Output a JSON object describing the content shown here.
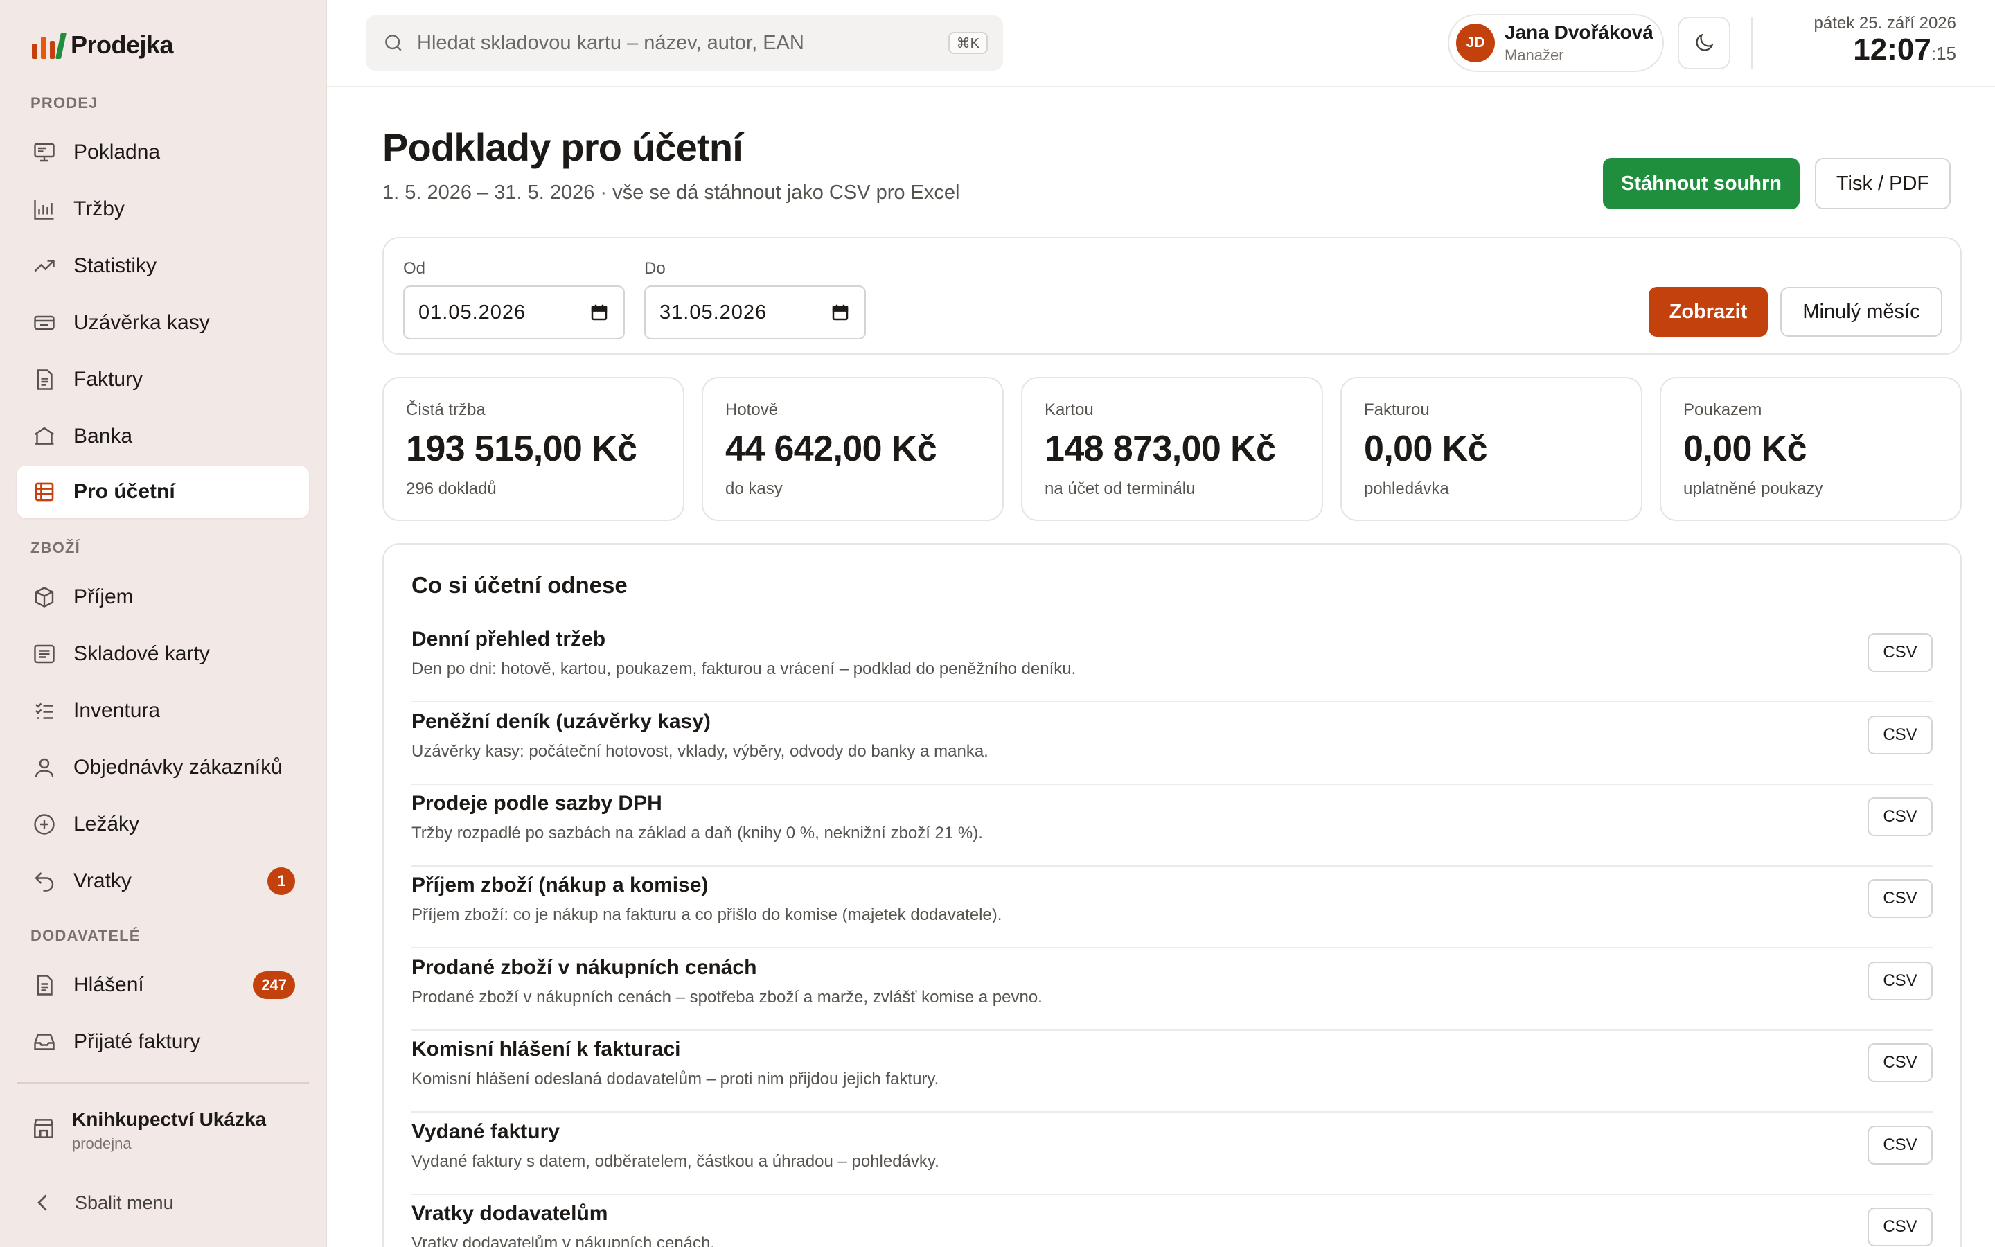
{
  "brand": {
    "name": "Prodejka",
    "colors": [
      "#c2410c",
      "#ea580c",
      "#c2410c",
      "#1f8f3e"
    ]
  },
  "sidebar": {
    "sections": [
      {
        "title": "PRODEJ",
        "items": [
          {
            "label": "Pokladna",
            "icon": "monitor-icon"
          },
          {
            "label": "Tržby",
            "icon": "bar-chart-icon"
          },
          {
            "label": "Statistiky",
            "icon": "trend-icon"
          },
          {
            "label": "Uzávěrka kasy",
            "icon": "cash-drawer-icon"
          },
          {
            "label": "Faktury",
            "icon": "document-icon"
          },
          {
            "label": "Banka",
            "icon": "bank-icon"
          },
          {
            "label": "Pro účetní",
            "icon": "table-icon",
            "active": true
          }
        ]
      },
      {
        "title": "ZBOŽÍ",
        "items": [
          {
            "label": "Příjem",
            "icon": "box-icon"
          },
          {
            "label": "Skladové karty",
            "icon": "list-card-icon"
          },
          {
            "label": "Inventura",
            "icon": "checklist-icon"
          },
          {
            "label": "Objednávky zákazníků",
            "icon": "user-icon"
          },
          {
            "label": "Ležáky",
            "icon": "plus-circle-icon"
          },
          {
            "label": "Vratky",
            "icon": "undo-icon",
            "badge": "1"
          }
        ]
      },
      {
        "title": "DODAVATELÉ",
        "items": [
          {
            "label": "Hlášení",
            "icon": "document-icon",
            "badge": "247"
          },
          {
            "label": "Přijaté faktury",
            "icon": "inbox-icon"
          }
        ]
      }
    ],
    "store": {
      "name": "Knihkupectví Ukázka",
      "sub": "prodejna"
    },
    "collapse_label": "Sbalit menu"
  },
  "topbar": {
    "search_placeholder": "Hledat skladovou kartu – název, autor, EAN",
    "shortcut": "⌘K",
    "user": {
      "initials": "JD",
      "name": "Jana Dvořáková",
      "role": "Manažer"
    },
    "date": "pátek 25. září 2026",
    "time": "12:07",
    "seconds": ":15"
  },
  "page": {
    "title": "Podklady pro účetní",
    "subtitle": "1. 5. 2026 – 31. 5. 2026 · vše se dá stáhnout jako CSV pro Excel",
    "download_label": "Stáhnout souhrn",
    "print_label": "Tisk / PDF"
  },
  "filter": {
    "from_label": "Od",
    "from_value": "01.05.2026",
    "to_label": "Do",
    "to_value": "31.05.2026",
    "show_label": "Zobrazit",
    "prev_month_label": "Minulý měsíc"
  },
  "kpis": [
    {
      "label": "Čistá tržba",
      "value": "193 515,00 Kč",
      "sub": "296 dokladů"
    },
    {
      "label": "Hotově",
      "value": "44 642,00 Kč",
      "sub": "do kasy"
    },
    {
      "label": "Kartou",
      "value": "148 873,00 Kč",
      "sub": "na účet od terminálu"
    },
    {
      "label": "Fakturou",
      "value": "0,00 Kč",
      "sub": "pohledávka"
    },
    {
      "label": "Poukazem",
      "value": "0,00 Kč",
      "sub": "uplatněné poukazy"
    }
  ],
  "exports": {
    "title": "Co si účetní odnese",
    "csv_label": "CSV",
    "rows": [
      {
        "title": "Denní přehled tržeb",
        "desc": "Den po dni: hotově, kartou, poukazem, fakturou a vrácení – podklad do peněžního deníku."
      },
      {
        "title": "Peněžní deník (uzávěrky kasy)",
        "desc": "Uzávěrky kasy: počáteční hotovost, vklady, výběry, odvody do banky a manka."
      },
      {
        "title": "Prodeje podle sazby DPH",
        "desc": "Tržby rozpadlé po sazbách na základ a daň (knihy 0 %, neknižní zboží 21 %)."
      },
      {
        "title": "Příjem zboží (nákup a komise)",
        "desc": "Příjem zboží: co je nákup na fakturu a co přišlo do komise (majetek dodavatele)."
      },
      {
        "title": "Prodané zboží v nákupních cenách",
        "desc": "Prodané zboží v nákupních cenách – spotřeba zboží a marže, zvlášť komise a pevno."
      },
      {
        "title": "Komisní hlášení k fakturaci",
        "desc": "Komisní hlášení odeslaná dodavatelům – proti nim přijdou jejich faktury."
      },
      {
        "title": "Vydané faktury",
        "desc": "Vydané faktury s datem, odběratelem, částkou a úhradou – pohledávky."
      },
      {
        "title": "Vratky dodavatelům",
        "desc": "Vratky dodavatelům v nákupních cenách."
      }
    ]
  }
}
